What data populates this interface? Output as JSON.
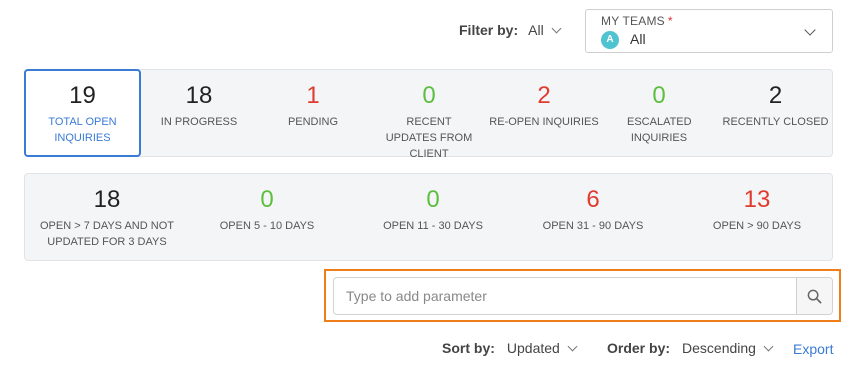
{
  "filter": {
    "label": "Filter by:",
    "value": "All"
  },
  "my_teams": {
    "caption": "MY TEAMS",
    "required_mark": "*",
    "avatar_letter": "A",
    "value": "All"
  },
  "stats_row1": [
    {
      "value": "19",
      "label": "TOTAL OPEN INQUIRIES",
      "color": "#222222",
      "active": true
    },
    {
      "value": "18",
      "label": "IN PROGRESS",
      "color": "#222222"
    },
    {
      "value": "1",
      "label": "PENDING",
      "color": "#e03b2f"
    },
    {
      "value": "0",
      "label": "RECENT UPDATES FROM CLIENT",
      "color": "#5cbf3e"
    },
    {
      "value": "2",
      "label": "RE-OPEN INQUIRIES",
      "color": "#e03b2f"
    },
    {
      "value": "0",
      "label": "ESCALATED INQUIRIES",
      "color": "#5cbf3e"
    },
    {
      "value": "2",
      "label": "RECENTLY CLOSED",
      "color": "#222222"
    }
  ],
  "stats_row2": [
    {
      "value": "18",
      "label": "OPEN > 7 DAYS AND NOT UPDATED FOR 3 DAYS",
      "color": "#222222"
    },
    {
      "value": "0",
      "label": "OPEN 5 - 10 DAYS",
      "color": "#5cbf3e"
    },
    {
      "value": "0",
      "label": "OPEN 11 - 30 DAYS",
      "color": "#5cbf3e"
    },
    {
      "value": "6",
      "label": "OPEN 31 - 90 DAYS",
      "color": "#e03b2f"
    },
    {
      "value": "13",
      "label": "OPEN > 90 DAYS",
      "color": "#e03b2f"
    }
  ],
  "search": {
    "placeholder": "Type to add parameter",
    "icon": "search-icon"
  },
  "sort": {
    "label": "Sort by:",
    "value": "Updated"
  },
  "order": {
    "label": "Order by:",
    "value": "Descending"
  },
  "export_label": "Export",
  "colors": {
    "accent": "#3a7bd5",
    "highlight_border": "#ef7d1a",
    "red": "#e03b2f",
    "green": "#5cbf3e"
  }
}
